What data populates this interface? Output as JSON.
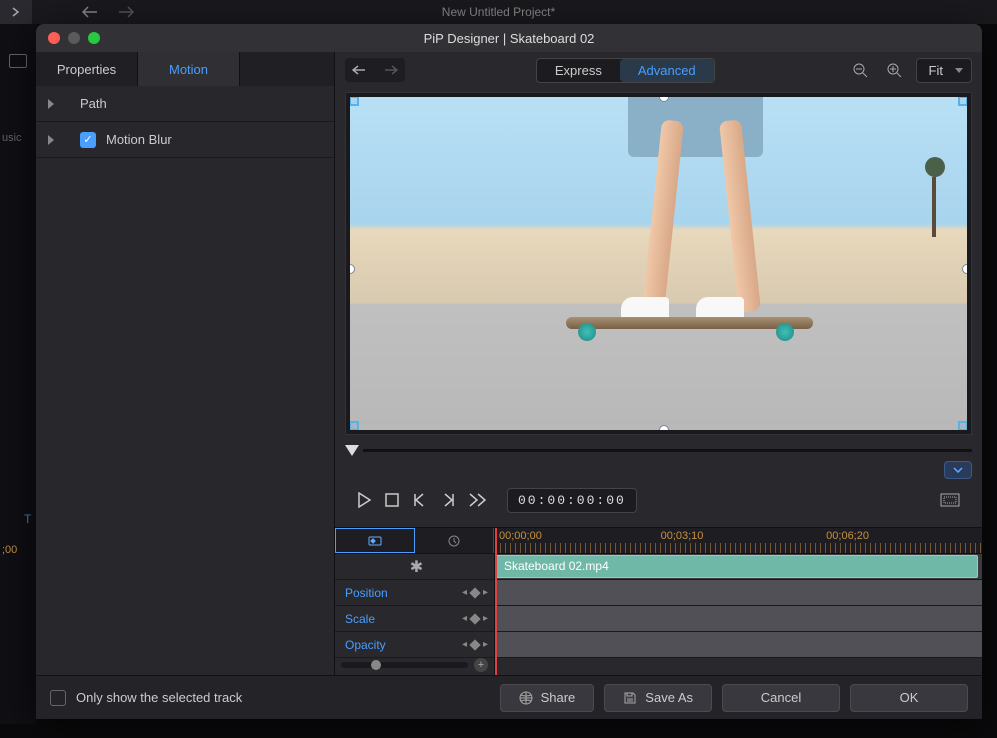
{
  "background": {
    "project_title": "New Untitled Project*",
    "left_label": "usic",
    "left_t": "T",
    "left_time": ";00"
  },
  "modal": {
    "title": "PiP Designer  |  Skateboard 02"
  },
  "left_panel": {
    "tabs": {
      "properties": "Properties",
      "motion": "Motion"
    },
    "items": {
      "path": "Path",
      "motion_blur": "Motion Blur"
    }
  },
  "toolbar": {
    "mode_express": "Express",
    "mode_advanced": "Advanced",
    "zoom_fit": "Fit"
  },
  "transport": {
    "timecode": "00:00:00:00"
  },
  "timeline": {
    "ruler": [
      "00;00;00",
      "00;03;10",
      "00;06;20"
    ],
    "clip_name": "Skateboard 02.mp4",
    "tracks": {
      "position": "Position",
      "scale": "Scale",
      "opacity": "Opacity"
    }
  },
  "footer": {
    "only_selected": "Only show the selected track",
    "share": "Share",
    "save_as": "Save As",
    "cancel": "Cancel",
    "ok": "OK"
  }
}
